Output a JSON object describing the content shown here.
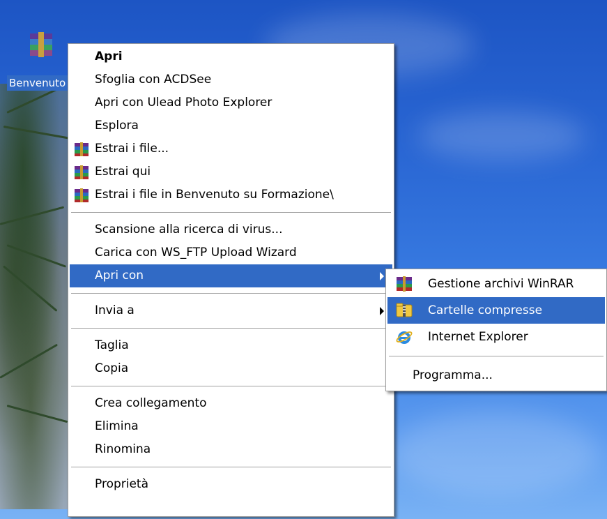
{
  "desktop": {
    "icon": {
      "label": "Benvenuto su Formazione",
      "icon_name": "winrar-archive-icon"
    }
  },
  "context_menu": {
    "items": [
      {
        "label": "Apri",
        "bold": true
      },
      {
        "label": "Sfoglia con ACDSee"
      },
      {
        "label": "Apri con Ulead Photo Explorer"
      },
      {
        "label": "Esplora"
      },
      {
        "label": "Estrai i file...",
        "icon": "winrar-icon"
      },
      {
        "label": "Estrai qui",
        "icon": "winrar-icon"
      },
      {
        "label": "Estrai i file in Benvenuto su Formazione\\",
        "icon": "winrar-icon"
      },
      {
        "label": "Scansione alla ricerca di virus..."
      },
      {
        "label": "Carica con WS_FTP Upload Wizard"
      },
      {
        "label": "Apri con",
        "submenu": true,
        "selected": true
      },
      {
        "label": "Invia a",
        "submenu": true
      },
      {
        "label": "Taglia"
      },
      {
        "label": "Copia"
      },
      {
        "label": "Crea collegamento"
      },
      {
        "label": "Elimina"
      },
      {
        "label": "Rinomina"
      },
      {
        "label": "Proprietà"
      }
    ]
  },
  "submenu": {
    "items": [
      {
        "label": "Gestione archivi WinRAR",
        "icon": "winrar-icon"
      },
      {
        "label": "Cartelle compresse",
        "icon": "zip-folder-icon",
        "selected": true
      },
      {
        "label": "Internet Explorer",
        "icon": "internet-explorer-icon"
      },
      {
        "label": "Programma..."
      }
    ]
  },
  "colors": {
    "selection": "#316ac5",
    "desktop_blue": "#2a67d4"
  }
}
